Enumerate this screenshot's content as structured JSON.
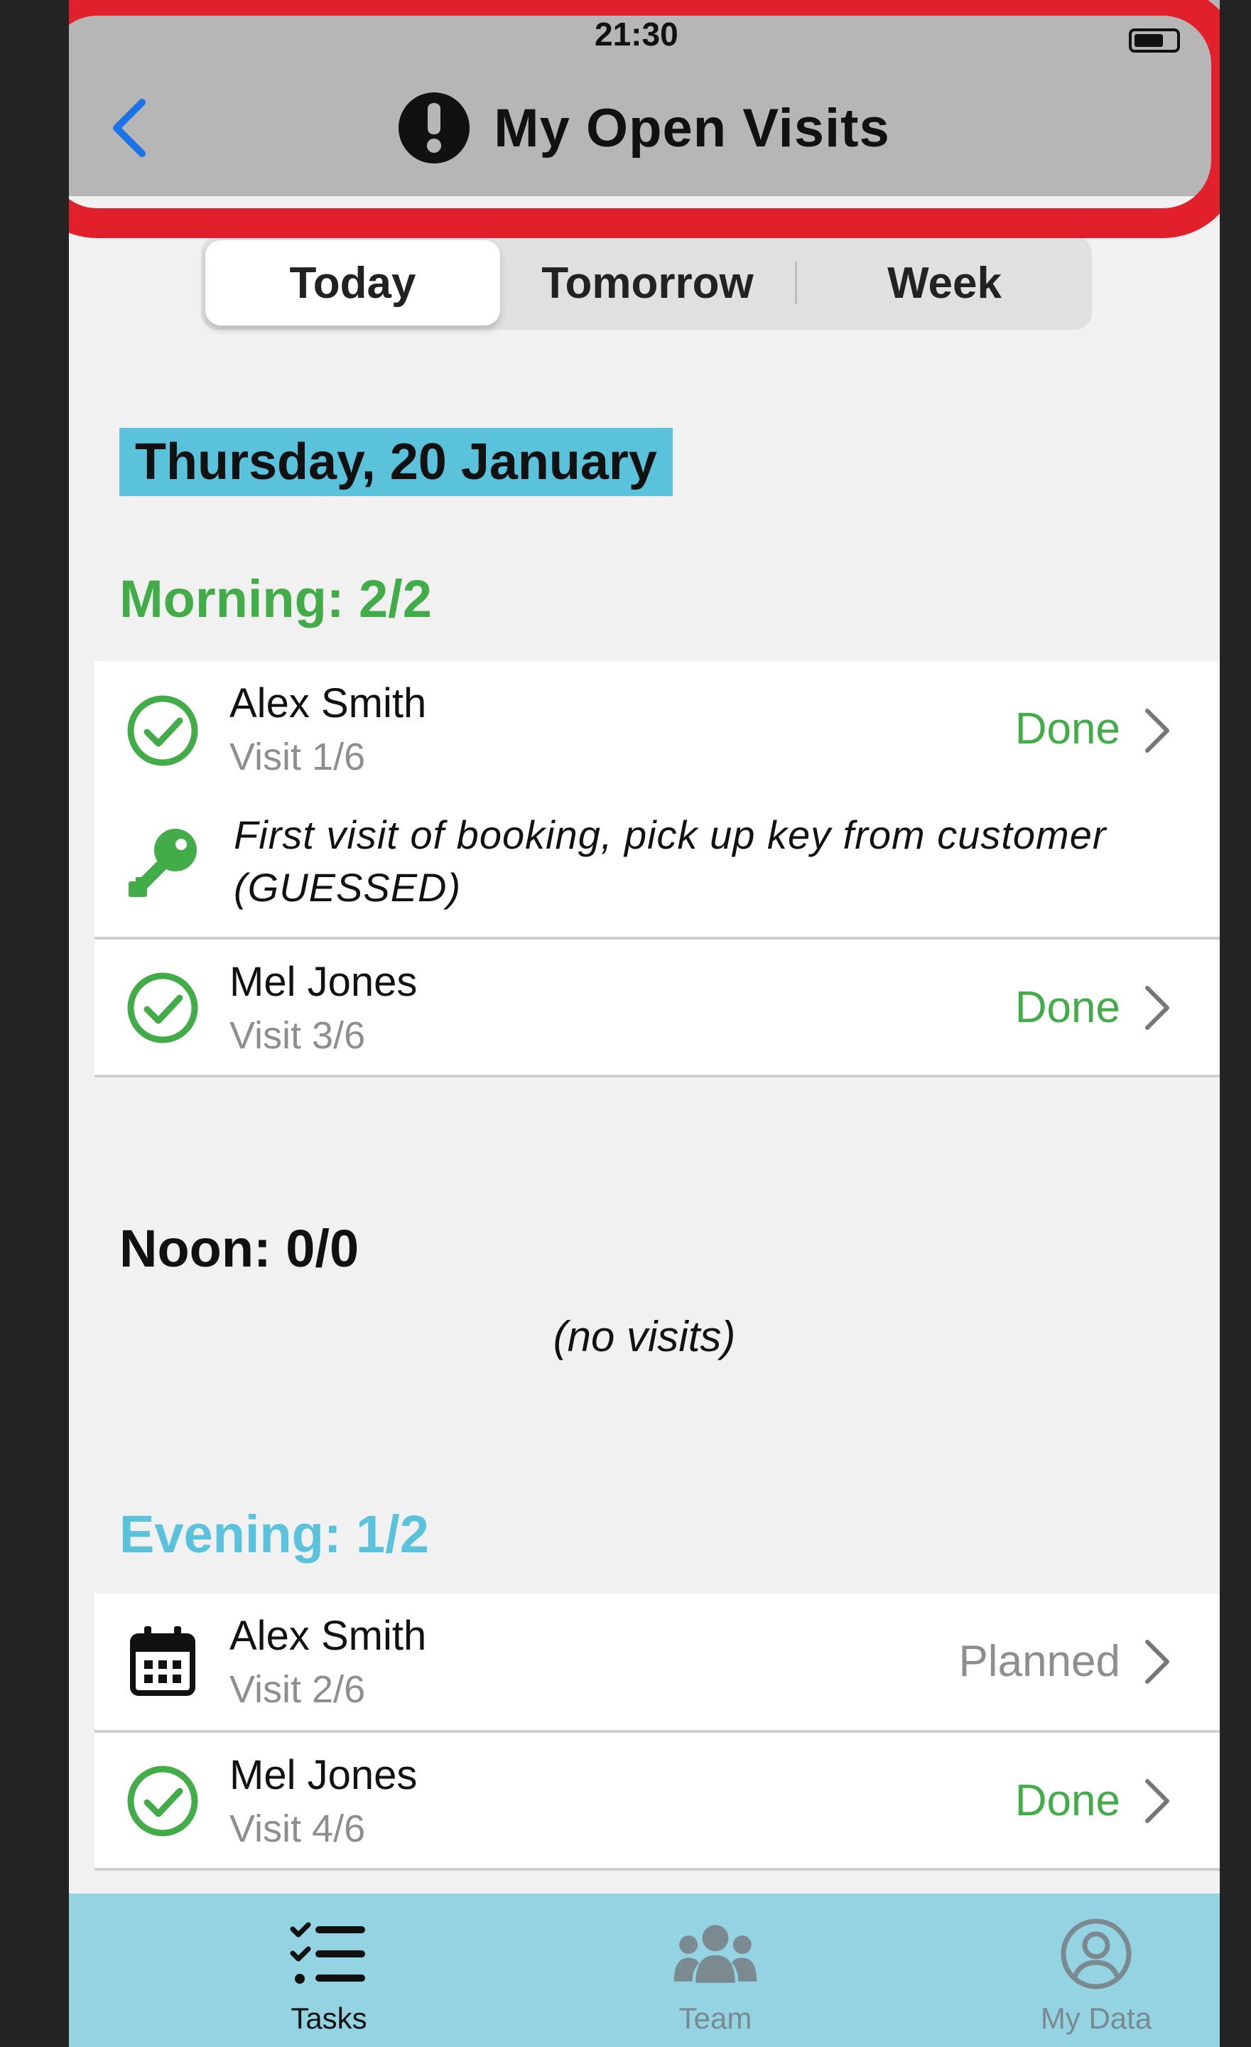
{
  "header": {
    "status_time": "21:30",
    "title": "My Open Visits"
  },
  "tabs": {
    "today": "Today",
    "tomorrow": "Tomorrow",
    "week": "Week"
  },
  "date": "Thursday, 20 January",
  "sections": {
    "morning": {
      "title": "Morning: 2/2",
      "visits": [
        {
          "name": "Alex Smith",
          "visit": "Visit 1/6",
          "status": "Done",
          "note": "First visit of booking, pick up key from customer (GUESSED)"
        },
        {
          "name": "Mel Jones",
          "visit": "Visit 3/6",
          "status": "Done"
        }
      ]
    },
    "noon": {
      "title": "Noon: 0/0",
      "empty": "(no visits)"
    },
    "evening": {
      "title": "Evening: 1/2",
      "visits": [
        {
          "name": "Alex Smith",
          "visit": "Visit 2/6",
          "status": "Planned"
        },
        {
          "name": "Mel Jones",
          "visit": "Visit 4/6",
          "status": "Done"
        }
      ]
    }
  },
  "tabbar": {
    "tasks": "Tasks",
    "team": "Team",
    "mydata": "My Data"
  },
  "colors": {
    "green": "#42ac48",
    "blue": "#1a73e8",
    "accent": "#5bc2dc",
    "highlight": "#e2202c"
  },
  "icons": {
    "back": "chevron-left-icon",
    "alert": "exclamation-circle-icon",
    "done": "check-circle-icon",
    "planned": "calendar-icon",
    "key": "key-icon",
    "tasks": "task-list-icon",
    "team": "team-icon",
    "mydata": "user-circle-icon"
  }
}
